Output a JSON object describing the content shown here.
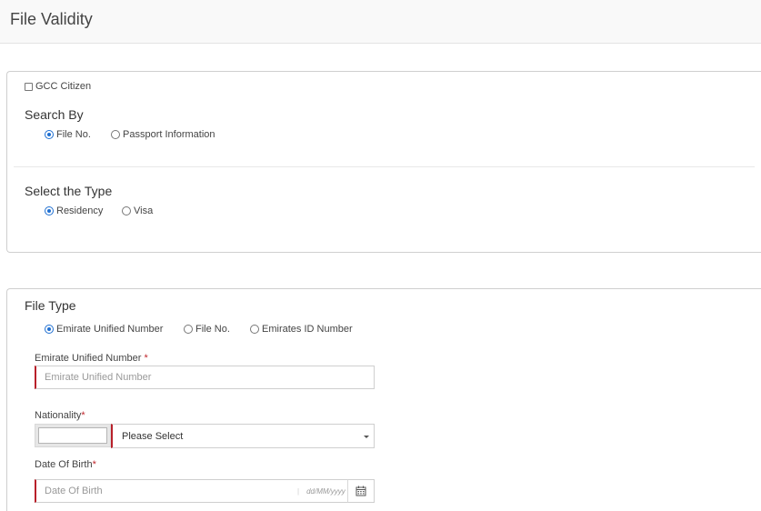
{
  "header": {
    "title": "File Validity"
  },
  "search_panel": {
    "gcc_citizen": {
      "label": "GCC Citizen",
      "checked": false
    },
    "search_by": {
      "title": "Search By",
      "options": [
        {
          "label": "File No.",
          "selected": true
        },
        {
          "label": "Passport Information",
          "selected": false
        }
      ]
    },
    "select_type": {
      "title": "Select the Type",
      "options": [
        {
          "label": "Residency",
          "selected": true
        },
        {
          "label": "Visa",
          "selected": false
        }
      ]
    }
  },
  "file_panel": {
    "file_type": {
      "title": "File Type",
      "options": [
        {
          "label": "Emirate Unified Number",
          "selected": true
        },
        {
          "label": "File No.",
          "selected": false
        },
        {
          "label": "Emirates ID Number",
          "selected": false
        }
      ]
    },
    "unified_number": {
      "label": "Emirate Unified Number",
      "required_mark": "*",
      "placeholder": "Emirate Unified Number",
      "value": ""
    },
    "nationality": {
      "label": "Nationality",
      "required_mark": "*",
      "code_value": "",
      "selected": "Please Select"
    },
    "dob": {
      "label": "Date Of Birth",
      "required_mark": "*",
      "placeholder": "Date Of Birth",
      "format_hint": "dd/MM/yyyy",
      "separator": "|",
      "icon": "calendar-icon"
    }
  },
  "colors": {
    "accent_required": "#b8202a",
    "radio_selected": "#1f6fd1"
  }
}
